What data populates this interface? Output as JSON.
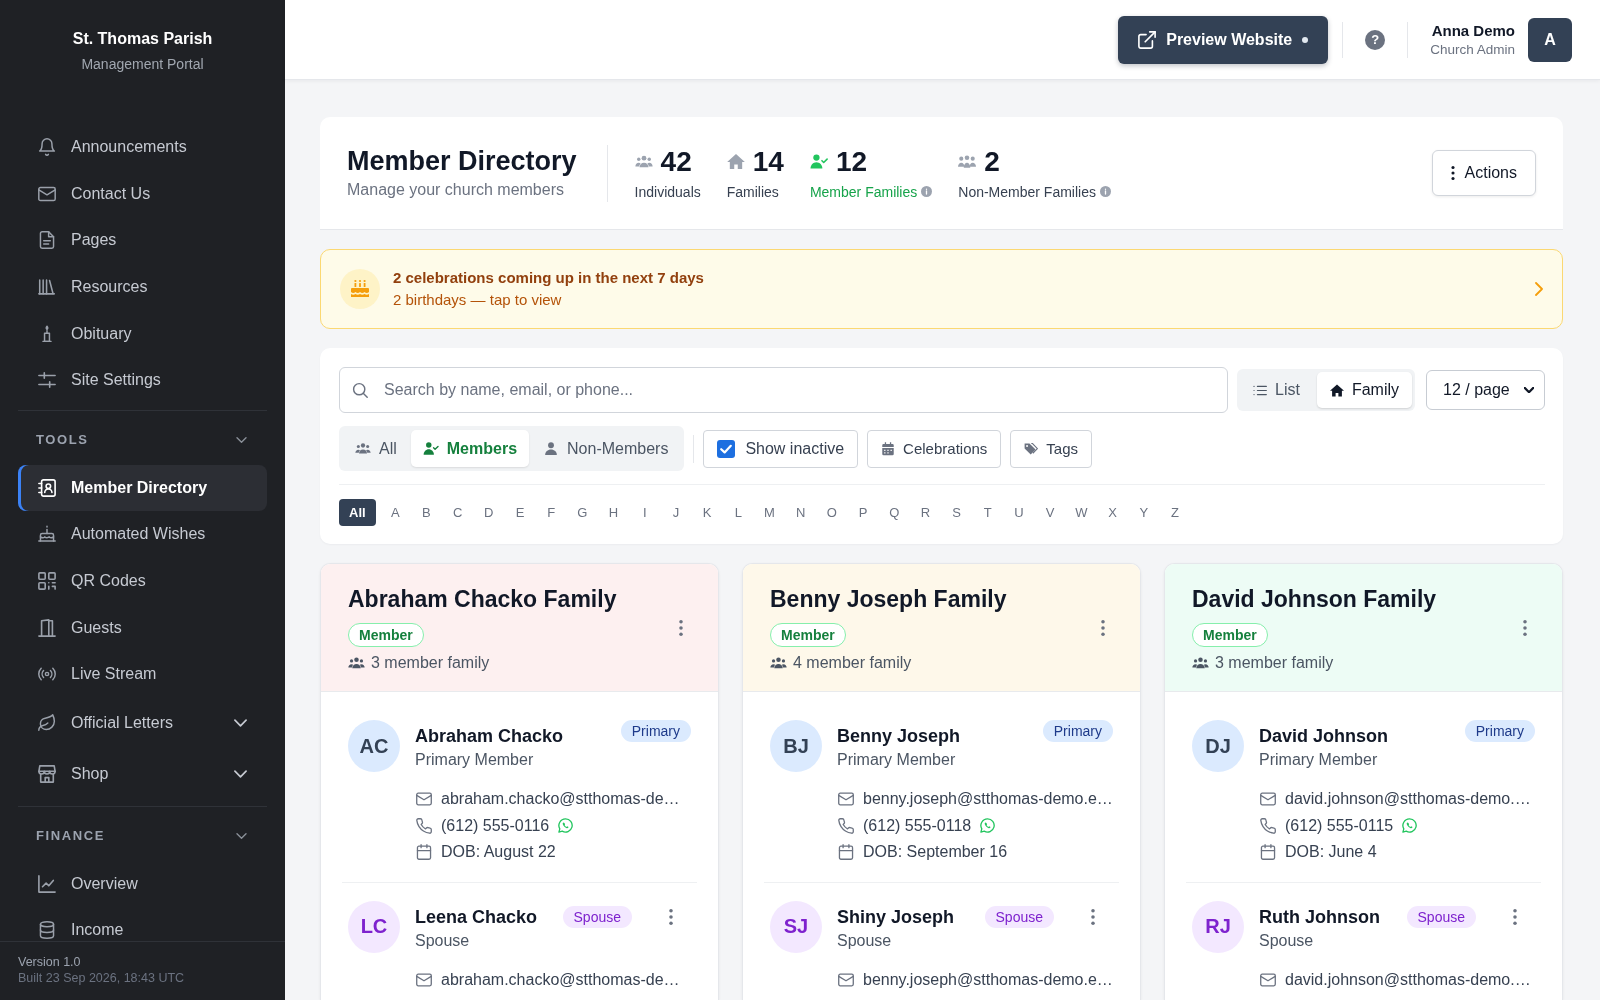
{
  "sidebar": {
    "brand": {
      "title": "St. Thomas Parish",
      "subtitle": "Management Portal"
    },
    "items": [
      {
        "label": "Announcements",
        "kind": "link",
        "selected": false
      },
      {
        "label": "Contact Us",
        "kind": "link",
        "selected": false
      },
      {
        "label": "Pages",
        "kind": "link",
        "selected": false
      },
      {
        "label": "Resources",
        "kind": "link",
        "selected": false
      },
      {
        "label": "Obituary",
        "kind": "link",
        "selected": false
      },
      {
        "label": "Site Settings",
        "kind": "link",
        "selected": false
      }
    ],
    "sections": [
      {
        "title": "TOOLS",
        "expanded": true,
        "items": [
          {
            "label": "Member Directory",
            "kind": "link",
            "selected": true
          },
          {
            "label": "Automated Wishes",
            "kind": "link",
            "selected": false
          },
          {
            "label": "QR Codes",
            "kind": "link",
            "selected": false
          },
          {
            "label": "Guests",
            "kind": "link",
            "selected": false
          },
          {
            "label": "Live Stream",
            "kind": "link",
            "selected": false
          },
          {
            "label": "Official Letters",
            "kind": "group",
            "selected": false
          },
          {
            "label": "Shop",
            "kind": "group",
            "selected": false
          }
        ]
      },
      {
        "title": "FINANCE",
        "expanded": true,
        "items": [
          {
            "label": "Overview",
            "kind": "link",
            "selected": false
          },
          {
            "label": "Income",
            "kind": "link",
            "selected": false
          }
        ]
      }
    ],
    "footer": {
      "version": "Version 1.0",
      "build": "Built 23 Sep 2026, 18:43 UTC"
    }
  },
  "top_bar": {
    "preview_button": {
      "label": "Preview Website"
    },
    "help_button": {
      "label": "?"
    },
    "user": {
      "name": "Anna Demo",
      "role": "Church Admin",
      "initial": "A"
    }
  },
  "header": {
    "title": "Member Directory",
    "subtitle": "Manage your church members",
    "stats": [
      {
        "value": "42",
        "label": "Individuals",
        "selected": false,
        "info": false
      },
      {
        "value": "14",
        "label": "Families",
        "selected": false,
        "info": false
      },
      {
        "value": "12",
        "label": "Member Families",
        "selected": true,
        "info": true
      },
      {
        "value": "2",
        "label": "Non-Member Families",
        "selected": false,
        "info": true
      }
    ],
    "actions_button": {
      "label": "Actions"
    }
  },
  "banner": {
    "title": "2 celebrations coming up in the next 7 days",
    "subtitle": "2 birthdays — tap to view"
  },
  "filters": {
    "search": {
      "placeholder": "Search by name, email, or phone..."
    },
    "view_toggle": [
      {
        "label": "List",
        "selected": false
      },
      {
        "label": "Family",
        "selected": true
      }
    ],
    "page_size": {
      "value": "12 / page"
    },
    "membership": [
      {
        "label": "All",
        "selected": false
      },
      {
        "label": "Members",
        "selected": true
      },
      {
        "label": "Non-Members",
        "selected": false
      }
    ],
    "show_inactive": {
      "label": "Show inactive",
      "checked": true
    },
    "buttons": [
      {
        "label": "Celebrations"
      },
      {
        "label": "Tags"
      }
    ],
    "letters": [
      {
        "label": "All",
        "selected": true
      },
      {
        "label": "A",
        "selected": false
      },
      {
        "label": "B",
        "selected": false
      },
      {
        "label": "C",
        "selected": false
      },
      {
        "label": "D",
        "selected": false
      },
      {
        "label": "E",
        "selected": false
      },
      {
        "label": "F",
        "selected": false
      },
      {
        "label": "G",
        "selected": false
      },
      {
        "label": "H",
        "selected": false
      },
      {
        "label": "I",
        "selected": false
      },
      {
        "label": "J",
        "selected": false
      },
      {
        "label": "K",
        "selected": false
      },
      {
        "label": "L",
        "selected": false
      },
      {
        "label": "M",
        "selected": false
      },
      {
        "label": "N",
        "selected": false
      },
      {
        "label": "O",
        "selected": false
      },
      {
        "label": "P",
        "selected": false
      },
      {
        "label": "Q",
        "selected": false
      },
      {
        "label": "R",
        "selected": false
      },
      {
        "label": "S",
        "selected": false
      },
      {
        "label": "T",
        "selected": false
      },
      {
        "label": "U",
        "selected": false
      },
      {
        "label": "V",
        "selected": false
      },
      {
        "label": "W",
        "selected": false
      },
      {
        "label": "X",
        "selected": false
      },
      {
        "label": "Y",
        "selected": false
      },
      {
        "label": "Z",
        "selected": false
      }
    ]
  },
  "families": [
    {
      "name": "Abraham Chacko Family",
      "color": "#fdf0f0",
      "status": "Member",
      "size": "3 member family",
      "members": [
        {
          "kind": "primary",
          "initials": "AC",
          "name": "Abraham Chacko",
          "badge": "Primary",
          "role": "Primary Member",
          "email": "abraham.chacko@stthomas-de…",
          "phone": "(612) 555-0116",
          "whatsapp": true,
          "dob": "DOB: August 22"
        },
        {
          "kind": "spouse",
          "initials": "LC",
          "name": "Leena Chacko",
          "badge": "Spouse",
          "role": "Spouse",
          "email": "abraham.chacko@stthomas-de…"
        }
      ]
    },
    {
      "name": "Benny Joseph Family",
      "color": "#fef8ea",
      "status": "Member",
      "size": "4 member family",
      "members": [
        {
          "kind": "primary",
          "initials": "BJ",
          "name": "Benny Joseph",
          "badge": "Primary",
          "role": "Primary Member",
          "email": "benny.joseph@stthomas-demo.e…",
          "phone": "(612) 555-0118",
          "whatsapp": true,
          "dob": "DOB: September 16"
        },
        {
          "kind": "spouse",
          "initials": "SJ",
          "name": "Shiny Joseph",
          "badge": "Spouse",
          "role": "Spouse",
          "email": "benny.joseph@stthomas-demo.e…"
        }
      ]
    },
    {
      "name": "David Johnson Family",
      "color": "#edfcf5",
      "status": "Member",
      "size": "3 member family",
      "members": [
        {
          "kind": "primary",
          "initials": "DJ",
          "name": "David Johnson",
          "badge": "Primary",
          "role": "Primary Member",
          "email": "david.johnson@stthomas-demo.…",
          "phone": "(612) 555-0115",
          "whatsapp": true,
          "dob": "DOB: June 4"
        },
        {
          "kind": "spouse",
          "initials": "RJ",
          "name": "Ruth Johnson",
          "badge": "Spouse",
          "role": "Spouse",
          "email": "david.johnson@stthomas-demo.…"
        }
      ]
    }
  ]
}
